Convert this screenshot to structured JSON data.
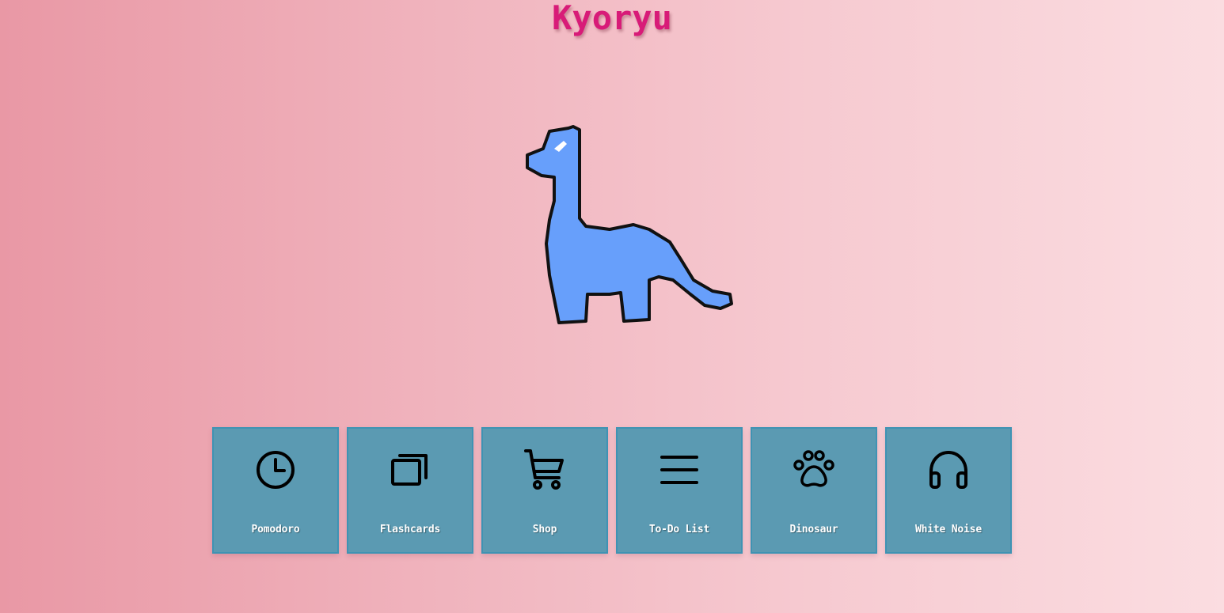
{
  "app": {
    "title": "Kyoryu"
  },
  "menu": {
    "items": [
      {
        "label": "Pomodoro",
        "icon": "clock-icon"
      },
      {
        "label": "Flashcards",
        "icon": "cards-icon"
      },
      {
        "label": "Shop",
        "icon": "cart-icon"
      },
      {
        "label": "To-Do List",
        "icon": "list-icon"
      },
      {
        "label": "Dinosaur",
        "icon": "paw-icon"
      },
      {
        "label": "White Noise",
        "icon": "headphones-icon"
      }
    ]
  },
  "colors": {
    "title": "#d81b78",
    "tile": "#5b9ab2",
    "dino": "#679ffb"
  }
}
